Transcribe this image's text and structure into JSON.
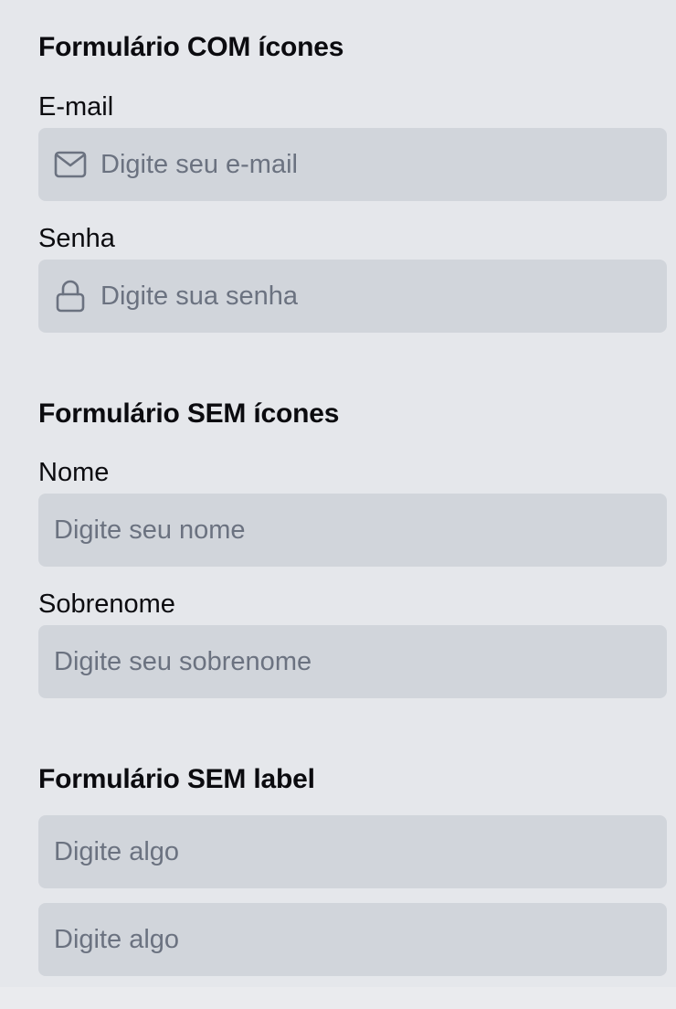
{
  "sections": [
    {
      "title": "Formulário COM ícones",
      "fields": [
        {
          "label": "E-mail",
          "placeholder": "Digite seu e-mail",
          "icon": "mail-icon"
        },
        {
          "label": "Senha",
          "placeholder": "Digite sua senha",
          "icon": "lock-icon"
        }
      ]
    },
    {
      "title": "Formulário SEM ícones",
      "fields": [
        {
          "label": "Nome",
          "placeholder": "Digite seu nome"
        },
        {
          "label": "Sobrenome",
          "placeholder": "Digite seu sobrenome"
        }
      ]
    },
    {
      "title": "Formulário SEM label",
      "fields": [
        {
          "placeholder": "Digite algo"
        },
        {
          "placeholder": "Digite algo"
        }
      ]
    }
  ],
  "colors": {
    "background": "#e5e7eb",
    "input_background": "#d1d5db",
    "placeholder": "#6b7280",
    "icon": "#6b7280",
    "text": "#0b0b0f"
  }
}
